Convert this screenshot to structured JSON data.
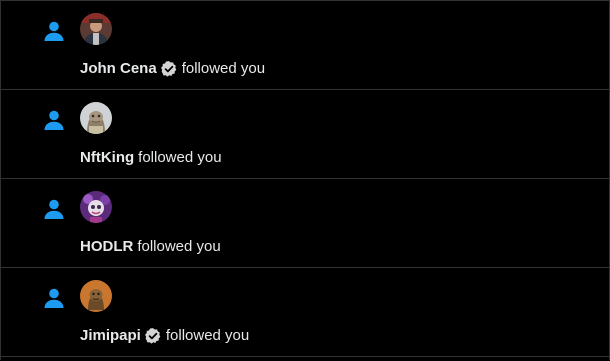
{
  "notifications": [
    {
      "type_icon": "person-icon",
      "avatar": "john-cena-avatar",
      "user": "John Cena",
      "verified": true,
      "action": "followed you"
    },
    {
      "type_icon": "person-icon",
      "avatar": "nftking-avatar",
      "user": "NftKing",
      "verified": false,
      "action": "followed you"
    },
    {
      "type_icon": "person-icon",
      "avatar": "hodlr-avatar",
      "user": "HODLR",
      "verified": false,
      "action": "followed you"
    },
    {
      "type_icon": "person-icon",
      "avatar": "jimipapi-avatar",
      "user": "Jimipapi",
      "verified": true,
      "action": "followed you"
    }
  ],
  "colors": {
    "background": "#000000",
    "divider": "#2f3336",
    "accent": "#1d9bf0",
    "text": "#e7e9ea",
    "badge": "#d4d4d4"
  }
}
